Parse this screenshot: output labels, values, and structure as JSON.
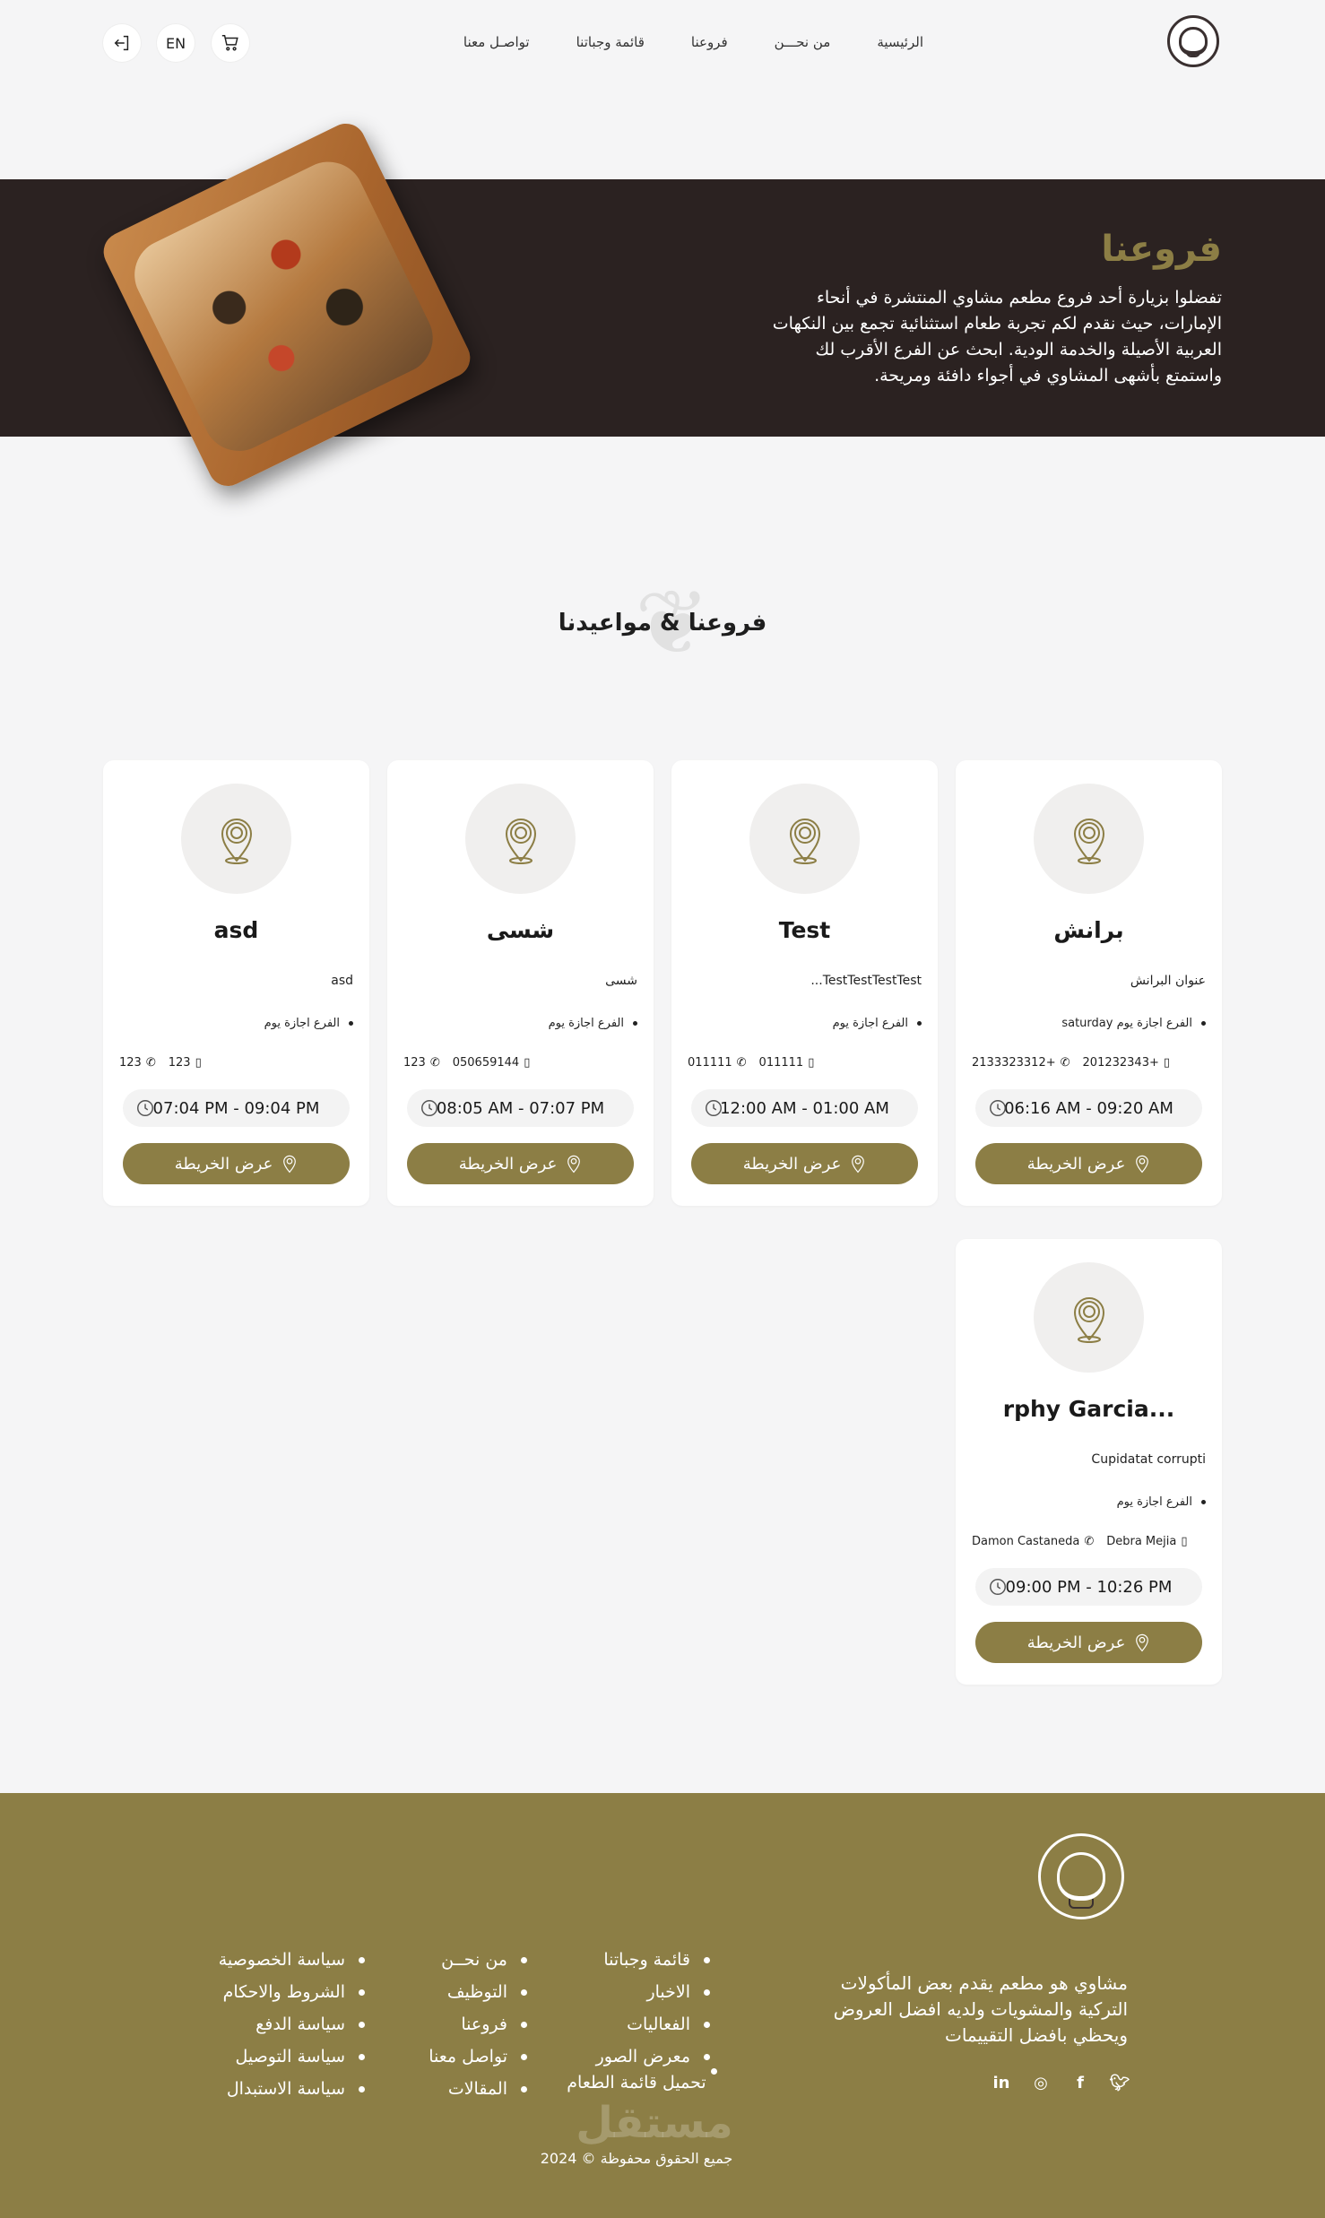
{
  "nav": {
    "items": [
      "الرئيسية",
      "من نحـــن",
      "فروعنا",
      "قائمة وجباتنا",
      "تواصـل معنا"
    ],
    "lang": "EN"
  },
  "hero": {
    "title": "فروعنا",
    "text": "تفضلوا بزيارة أحد فروع مطعم مشاوي المنتشرة في أنحاء الإمارات، حيث نقدم لكم تجربة طعام استثنائية تجمع بين النكهات العربية الأصيلة والخدمة الودية. ابحث عن الفرع الأقرب لك واستمتع بأشهى المشاوي في أجواء دافئة ومريحة."
  },
  "section": {
    "title": "فروعنا & مواعيدنا"
  },
  "branches": [
    {
      "name": "برانش",
      "address": "عنوان البرانش",
      "status": "الفرع اجازة يوم saturday",
      "mobile": "+201232343",
      "phone": "+2133323312",
      "hours": "06:16 AM - 09:20 AM",
      "map_label": "عرض الخريطة"
    },
    {
      "name": "Test",
      "address": "TestTestTestTest...",
      "status": "الفرع اجازة يوم",
      "mobile": "011111",
      "phone": "011111",
      "hours": "12:00 AM - 01:00 AM",
      "map_label": "عرض الخريطة"
    },
    {
      "name": "شسى",
      "address": "شسى",
      "status": "الفرع اجازة يوم",
      "mobile": "050659144",
      "phone": "123",
      "hours": "08:05 AM - 07:07 PM",
      "map_label": "عرض الخريطة"
    },
    {
      "name": "asd",
      "address": "asd",
      "status": "الفرع اجازة يوم",
      "mobile": "123",
      "phone": "123",
      "hours": "07:04 PM - 09:04 PM",
      "map_label": "عرض الخريطة"
    },
    {
      "name": "...rphy Garcia",
      "address": "Cupidatat corrupti",
      "status": "الفرع اجازة يوم",
      "mobile": "Debra Mejia",
      "phone": "Damon Castaneda",
      "hours": "09:00 PM - 10:26 PM",
      "map_label": "عرض الخريطة"
    }
  ],
  "footer": {
    "description": "مشاوي هو مطعم يقدم بعض المأكولات التركية والمشويات ولديه افضل العروض ويحظي بافضل التقييمات",
    "col1": [
      "قائمة وجباتنا",
      "الاخبار",
      "الفعاليات",
      "معرض الصور"
    ],
    "col2": [
      "من نحــن",
      "التوظيف",
      "فروعنا",
      "تواصل معنا",
      "المقالات"
    ],
    "col3": [
      "سياسة الخصوصية",
      "الشروط والاحكام",
      "سياسة الدفع",
      "سياسة التوصيل",
      "سياسة الاستبدال"
    ],
    "menu_download": "تحميل قائمة الطعام",
    "copyright": "جميع الحقوق محفوظة © 2024",
    "watermark": "مستقل",
    "social": [
      "twitter-icon",
      "facebook-icon",
      "instagram-icon",
      "linkedin-icon"
    ]
  },
  "colors": {
    "accent": "#8c7e45",
    "hero_bg": "#2b2221",
    "page_bg": "#f5f5f6"
  }
}
